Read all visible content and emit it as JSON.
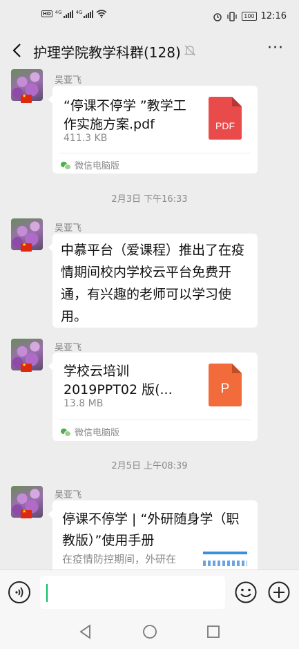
{
  "status_bar": {
    "network": "4G",
    "battery": "100",
    "time": "12:16"
  },
  "header": {
    "title": "护理学院教学科群(128)",
    "more": "···"
  },
  "messages": [
    {
      "sender": "吴亚飞",
      "file_name": "“停课不停学 ”教学工作实施方案.pdf",
      "file_size": "411.3 KB",
      "file_badge": "PDF",
      "source": "微信电脑版"
    },
    {
      "timestamp": "2月3日 下午16:33"
    },
    {
      "sender": "吴亚飞",
      "text": "中慕平台（爱课程）推出了在疫情期间校内学校云平台免费开通，有兴趣的老师可以学习使用。"
    },
    {
      "sender": "吴亚飞",
      "file_name": "学校云培训2019PPT02 版(...",
      "file_size": "13.8 MB",
      "file_badge": "P",
      "source": "微信电脑版"
    },
    {
      "timestamp": "2月5日 上午08:39"
    },
    {
      "sender": "吴亚飞",
      "link_title": "停课不停学 | “外研随身学（职教版）”使用手册",
      "link_desc": "在疫情防控期间，外研在"
    }
  ],
  "colors": {
    "pdf": "#e94b4b",
    "ppt": "#f26b3a",
    "accent": "#07c160"
  }
}
